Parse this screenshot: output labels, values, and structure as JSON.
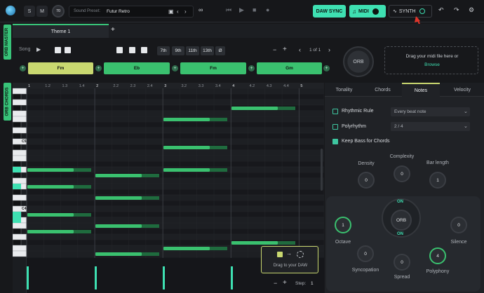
{
  "topbar": {
    "s_label": "S",
    "m_label": "M",
    "volume": "70",
    "preset_label": "Sound Preset:",
    "preset_value": "Futur Retro",
    "daw_sync": "DAW SYNC",
    "midi": "MIDI",
    "synth": "SYNTH"
  },
  "tabs": {
    "orb_master": "ORB MASTER",
    "orb_chords": "ORB CHORDS",
    "theme": "Theme 1",
    "add": "+"
  },
  "song": {
    "label": "Song",
    "ext": [
      "7th",
      "9th",
      "11th",
      "13th",
      "Ø"
    ],
    "pager": "1 of 1"
  },
  "chords": [
    "Fm",
    "Eb",
    "Fm",
    "Gm"
  ],
  "orb": "ORB",
  "drop": {
    "line1": "Drag your midi file here or",
    "browse": "Browse"
  },
  "roll": {
    "bars": [
      "1",
      "1.2",
      "1.3",
      "1.4",
      "2",
      "2.2",
      "2.3",
      "2.4",
      "3",
      "3.2",
      "3.3",
      "3.4",
      "4",
      "4.2",
      "4.3",
      "4.4",
      "5"
    ],
    "key_c5": "C5",
    "key_c4": "C4",
    "drag_label": "Drag to your DAW",
    "step_label": "Step:",
    "step_value": "1"
  },
  "panel": {
    "tabs": [
      "Tonality",
      "Chords",
      "Notes",
      "Velocity"
    ],
    "rhythmic_rule": "Rhythmic Rule",
    "rhythmic_value": "Every beat note",
    "polyrhythm": "Polyrhythm",
    "polyrhythm_value": "2 / 4",
    "keep_bass": "Keep Bass for Chords",
    "density": {
      "label": "Density",
      "value": "0"
    },
    "complexity": {
      "label": "Complexity",
      "value": "0"
    },
    "bar_length": {
      "label": "Bar length",
      "value": "1"
    },
    "octave": {
      "label": "Octave",
      "value": "1"
    },
    "silence": {
      "label": "Silence",
      "value": "0"
    },
    "syncopation": {
      "label": "Syncopation",
      "value": "0"
    },
    "spread": {
      "label": "Spread",
      "value": "0"
    },
    "polyphony": {
      "label": "Polyphony",
      "value": "4"
    },
    "orb_center": "ORB",
    "on_top": "ON",
    "on_bottom": "ON"
  },
  "colors": {
    "accent": "#3ee0b2",
    "note": "#3ac16f",
    "chord_fm": "#c9d870",
    "chord_other": "#3ac16f"
  }
}
